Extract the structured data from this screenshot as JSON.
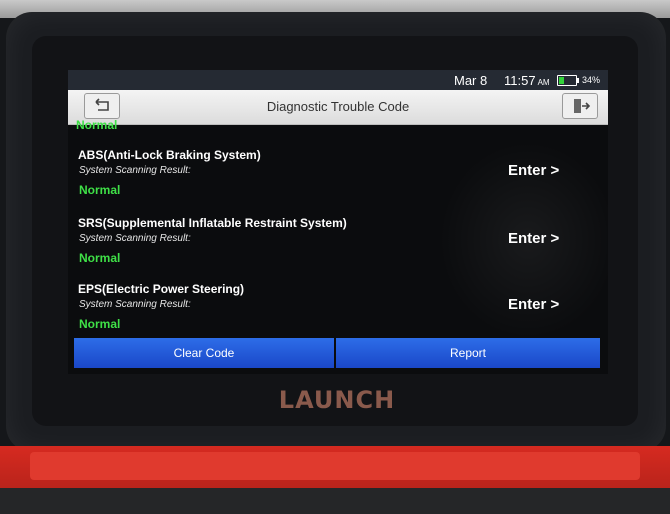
{
  "status_bar": {
    "date": "Mar 8",
    "time": "11:57",
    "ampm": "AM",
    "battery_percent": "34%",
    "battery_level": 0.34
  },
  "header": {
    "title": "Diagnostic Trouble Code"
  },
  "top_partial_result": "Normal",
  "systems": [
    {
      "name": "ABS(Anti-Lock Braking System)",
      "result_label": "System Scanning Result:",
      "result": "Normal",
      "action": "Enter >"
    },
    {
      "name": "SRS(Supplemental Inflatable Restraint System)",
      "result_label": "System Scanning Result:",
      "result": "Normal",
      "action": "Enter >"
    },
    {
      "name": "EPS(Electric Power Steering)",
      "result_label": "System Scanning Result:",
      "result": "Normal",
      "action": "Enter >"
    }
  ],
  "footer": {
    "clear_label": "Clear Code",
    "report_label": "Report"
  },
  "device": {
    "brand": "LAUNCH"
  },
  "colors": {
    "accent": "#1f55d6",
    "normal": "#3fe047",
    "titlebar": "#e6e6e6"
  },
  "icons": {
    "back": "back-arrow-icon",
    "exit": "exit-door-icon"
  }
}
